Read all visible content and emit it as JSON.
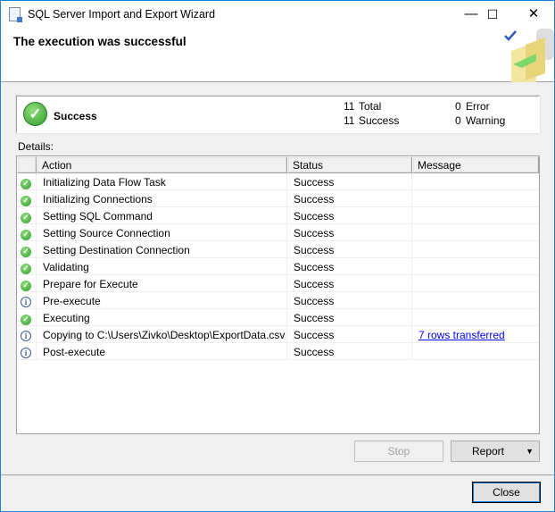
{
  "window": {
    "title": "SQL Server Import and Export Wizard"
  },
  "header": {
    "title": "The execution was successful"
  },
  "summary": {
    "status": "Success",
    "total": "11",
    "total_label": "Total",
    "success": "11",
    "success_label": "Success",
    "error": "0",
    "error_label": "Error",
    "warning": "0",
    "warning_label": "Warning"
  },
  "details": {
    "label": "Details:",
    "columns": [
      "Action",
      "Status",
      "Message"
    ],
    "rows": [
      {
        "icon": "success",
        "action": "Initializing Data Flow Task",
        "status": "Success",
        "message": ""
      },
      {
        "icon": "success",
        "action": "Initializing Connections",
        "status": "Success",
        "message": ""
      },
      {
        "icon": "success",
        "action": "Setting SQL Command",
        "status": "Success",
        "message": ""
      },
      {
        "icon": "success",
        "action": "Setting Source Connection",
        "status": "Success",
        "message": ""
      },
      {
        "icon": "success",
        "action": "Setting Destination Connection",
        "status": "Success",
        "message": ""
      },
      {
        "icon": "success",
        "action": "Validating",
        "status": "Success",
        "message": ""
      },
      {
        "icon": "success",
        "action": "Prepare for Execute",
        "status": "Success",
        "message": ""
      },
      {
        "icon": "info",
        "action": "Pre-execute",
        "status": "Success",
        "message": ""
      },
      {
        "icon": "success",
        "action": "Executing",
        "status": "Success",
        "message": ""
      },
      {
        "icon": "info",
        "action": "Copying to C:\\Users\\Zivko\\Desktop\\ExportData.csv",
        "status": "Success",
        "message": "7 rows transferred"
      },
      {
        "icon": "info",
        "action": "Post-execute",
        "status": "Success",
        "message": ""
      }
    ]
  },
  "buttons": {
    "stop": "Stop",
    "report": "Report",
    "close": "Close"
  }
}
